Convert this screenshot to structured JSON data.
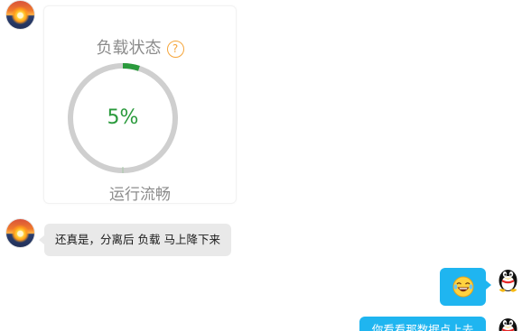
{
  "messages": {
    "status_card": {
      "title": "负载状态",
      "help_icon": "help-circle-icon",
      "load_percent": 5,
      "load_label": "5%",
      "status_text": "运行流畅",
      "colors": {
        "gauge_fill": "#2a9a3c",
        "gauge_track": "#cfcfcf",
        "help_icon": "#f5a53a"
      }
    },
    "reply_left": {
      "text": "还真是，分离后 负载 马上降下来"
    },
    "reply_right_emoji": {
      "emoji": "laughing-tears-emoji-icon"
    },
    "reply_right_text": {
      "text": "你看看那数据点上去"
    }
  },
  "avatars": {
    "left": "sunset-avatar",
    "right": "qq-penguin-avatar"
  },
  "colors": {
    "left_bubble": "#e9e9e9",
    "right_bubble": "#1fb5f0"
  }
}
